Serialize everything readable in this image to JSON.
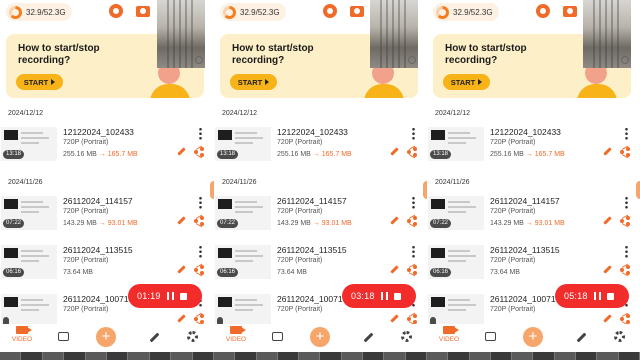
{
  "colors": {
    "accent": "#f06a2a",
    "record_pill": "#f22b2b",
    "banner_bg": "#fdf0c8",
    "start_button": "#f7b317"
  },
  "panels": [
    {
      "storage": "32.9/52.3G",
      "banner": {
        "title": "How to start/stop recording?",
        "start_label": "START"
      },
      "groups": [
        {
          "date": "2024/12/12",
          "items": [
            {
              "name": "12122024_102433",
              "resolution": "720P (Portrait)",
              "size": "255.16 MB",
              "arrow": "→",
              "compressed": "165.7 MB",
              "duration": "13:18"
            }
          ]
        },
        {
          "date": "2024/11/26",
          "items": [
            {
              "name": "26112024_114157",
              "resolution": "720P (Portrait)",
              "size": "143.29 MB",
              "arrow": "→",
              "compressed": "93.01 MB",
              "duration": "07:22"
            },
            {
              "name": "26112024_113515",
              "resolution": "720P (Portrait)",
              "size": "73.64 MB",
              "arrow": "",
              "compressed": "",
              "duration": "06:16"
            },
            {
              "name": "26112024_10071",
              "resolution": "720P (Portrait)",
              "size": "",
              "arrow": "",
              "compressed": "",
              "duration": ""
            }
          ]
        }
      ],
      "timer": "01:19",
      "nav": {
        "video_label": "VIDEO",
        "add_label": "+"
      }
    },
    {
      "storage": "32.9/52.3G",
      "banner": {
        "title": "How to start/stop recording?",
        "start_label": "START"
      },
      "groups": [
        {
          "date": "2024/12/12",
          "items": [
            {
              "name": "12122024_102433",
              "resolution": "720P (Portrait)",
              "size": "255.16 MB",
              "arrow": "→",
              "compressed": "165.7 MB",
              "duration": "13:18"
            }
          ]
        },
        {
          "date": "2024/11/26",
          "items": [
            {
              "name": "26112024_114157",
              "resolution": "720P (Portrait)",
              "size": "143.29 MB",
              "arrow": "→",
              "compressed": "93.01 MB",
              "duration": "07:22"
            },
            {
              "name": "26112024_113515",
              "resolution": "720P (Portrait)",
              "size": "73.64 MB",
              "arrow": "",
              "compressed": "",
              "duration": "06:16"
            },
            {
              "name": "26112024_10071",
              "resolution": "720P (Portrait)",
              "size": "",
              "arrow": "",
              "compressed": "",
              "duration": ""
            }
          ]
        }
      ],
      "timer": "03:18",
      "nav": {
        "video_label": "VIDEO",
        "add_label": "+"
      }
    },
    {
      "storage": "32.9/52.3G",
      "banner": {
        "title": "How to start/stop recording?",
        "start_label": "START"
      },
      "groups": [
        {
          "date": "2024/12/12",
          "items": [
            {
              "name": "12122024_102433",
              "resolution": "720P (Portrait)",
              "size": "255.16 MB",
              "arrow": "→",
              "compressed": "165.7 MB",
              "duration": "13:18"
            }
          ]
        },
        {
          "date": "2024/11/26",
          "items": [
            {
              "name": "26112024_114157",
              "resolution": "720P (Portrait)",
              "size": "143.29 MB",
              "arrow": "→",
              "compressed": "93.01 MB",
              "duration": "07:22"
            },
            {
              "name": "26112024_113515",
              "resolution": "720P (Portrait)",
              "size": "73.64 MB",
              "arrow": "",
              "compressed": "",
              "duration": "06:16"
            },
            {
              "name": "26112024_10071",
              "resolution": "720P (Portrait)",
              "size": "",
              "arrow": "",
              "compressed": "",
              "duration": ""
            }
          ]
        }
      ],
      "timer": "05:18",
      "nav": {
        "video_label": "VIDEO",
        "add_label": "+"
      }
    }
  ]
}
